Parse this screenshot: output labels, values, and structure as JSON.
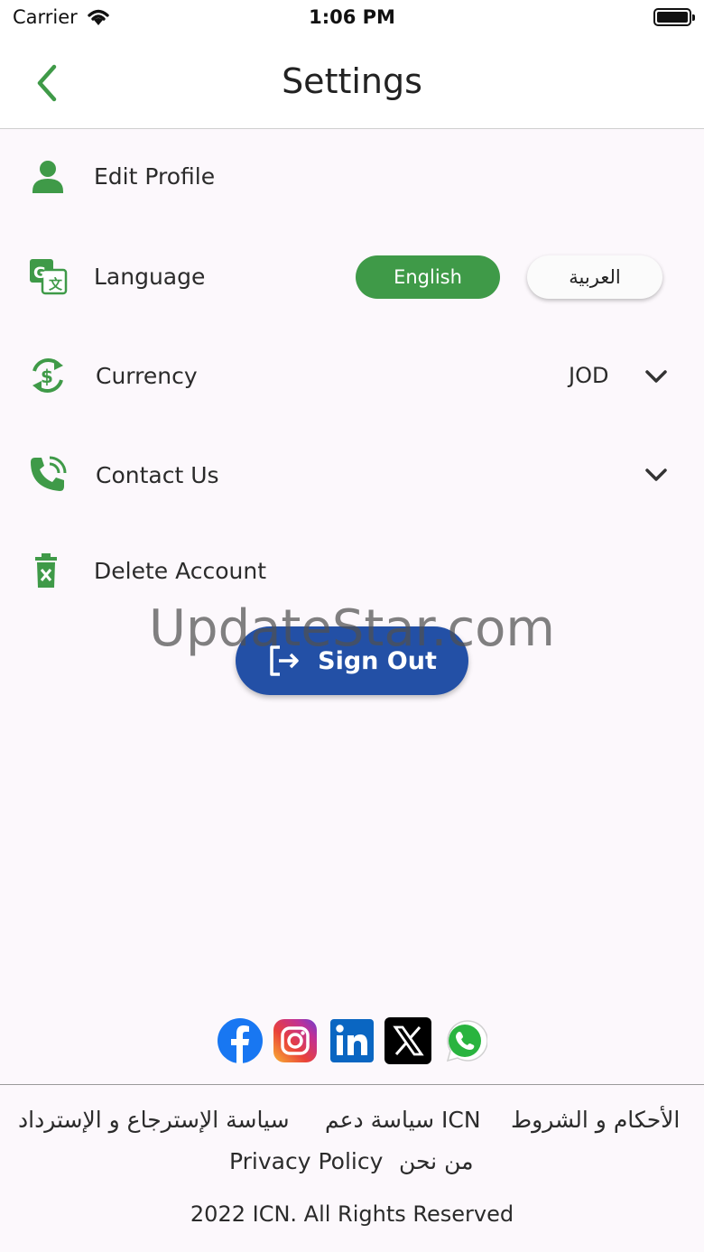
{
  "status_bar": {
    "carrier": "Carrier",
    "time": "1:06 PM"
  },
  "nav": {
    "title": "Settings"
  },
  "menu": {
    "edit_profile": "Edit Profile",
    "language": "Language",
    "currency": "Currency",
    "contact_us": "Contact Us",
    "delete_account": "Delete Account"
  },
  "language": {
    "english": "English",
    "arabic": "العربية",
    "selected": "English"
  },
  "currency": {
    "value": "JOD"
  },
  "watermark": "UpdateStar.com",
  "sign_out": "Sign Out",
  "social": {
    "facebook": "facebook-icon",
    "instagram": "instagram-icon",
    "linkedin": "linkedin-icon",
    "x": "x-icon",
    "whatsapp": "whatsapp-icon"
  },
  "footer": {
    "terms": "الأحكام و الشروط",
    "support_policy": "ICN سياسة دعم",
    "refund_policy": "سياسة الإسترجاع و الإسترداد",
    "about_us": "من نحن",
    "privacy_policy": "Privacy Policy",
    "copyright": "2022 ICN. All Rights Reserved"
  },
  "colors": {
    "accent_green": "#3f9a48",
    "sign_out_blue": "#2350a6",
    "background": "#fcf8fc"
  }
}
